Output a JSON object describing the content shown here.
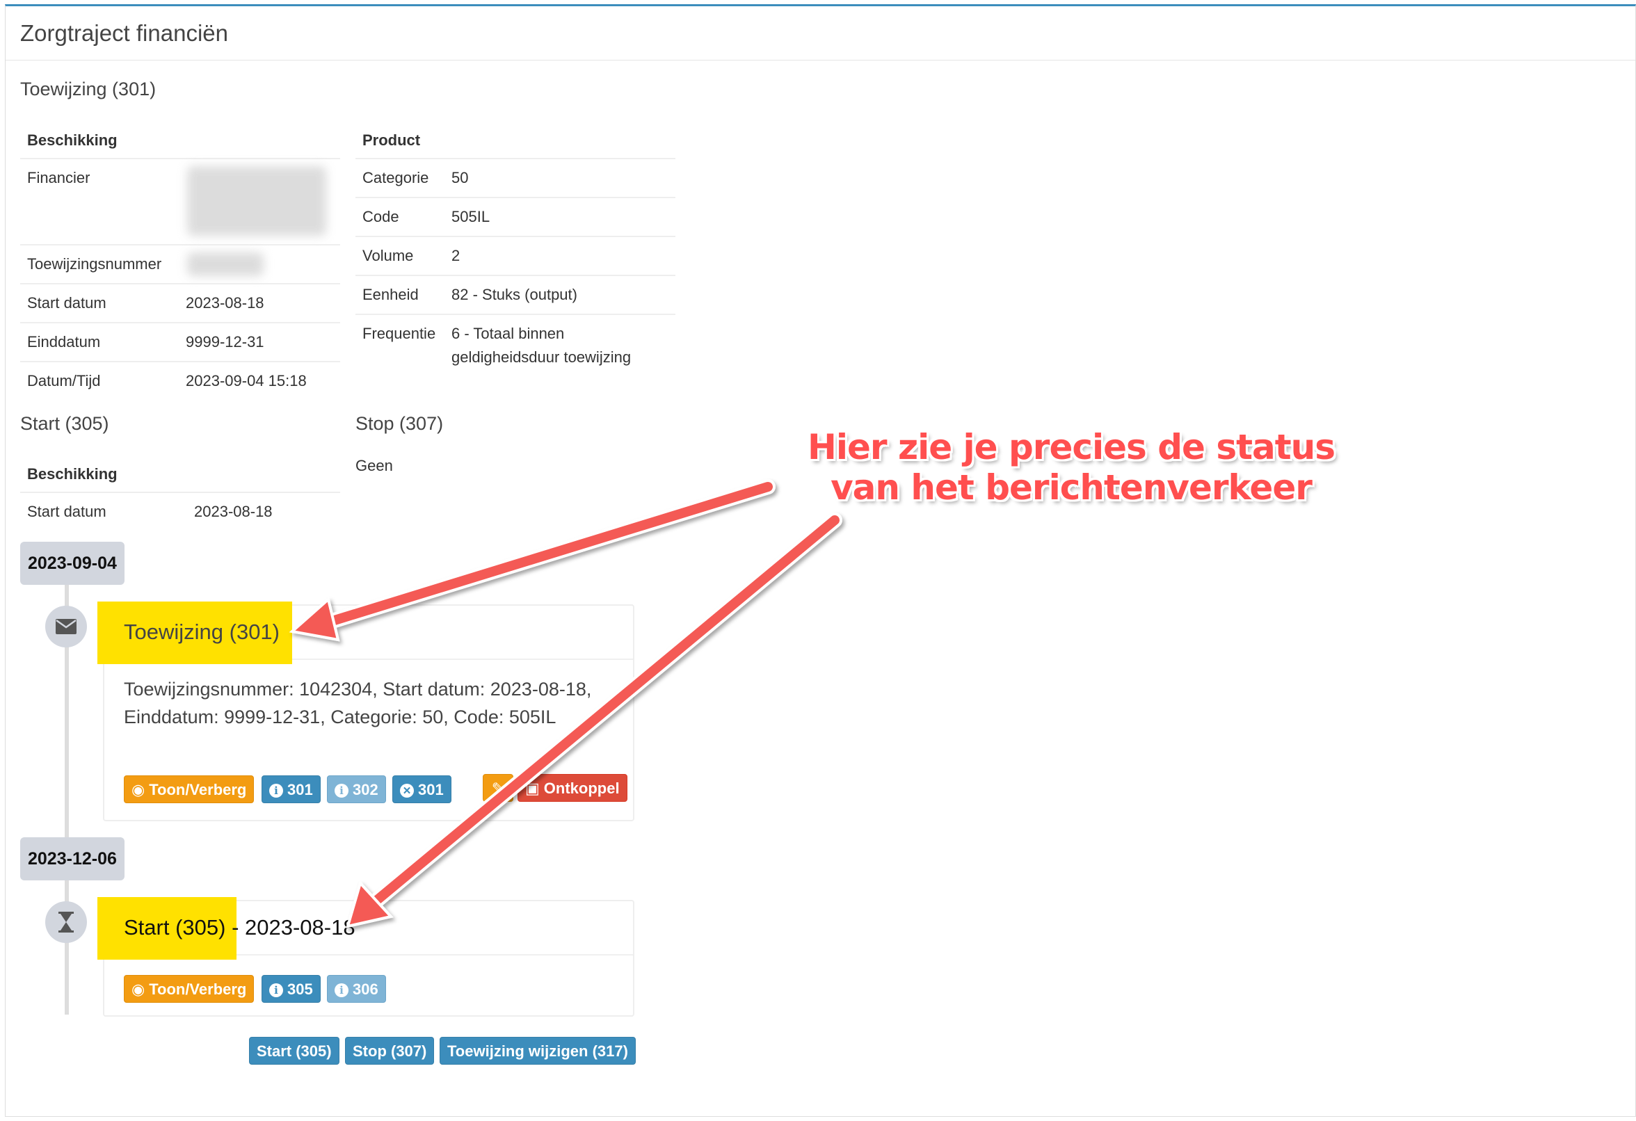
{
  "header": {
    "title": "Zorgtraject financiën"
  },
  "toewijzing": {
    "title": "Toewijzing (301)",
    "beschikking": {
      "heading": "Beschikking",
      "rows": [
        {
          "key": "Financier",
          "value": ""
        },
        {
          "key": "Toewijzingsnummer",
          "value": ""
        },
        {
          "key": "Start datum",
          "value": "2023-08-18"
        },
        {
          "key": "Einddatum",
          "value": "9999-12-31"
        },
        {
          "key": "Datum/Tijd",
          "value": "2023-09-04 15:18"
        }
      ]
    },
    "product": {
      "heading": "Product",
      "rows": [
        {
          "key": "Categorie",
          "value": "50"
        },
        {
          "key": "Code",
          "value": "505IL"
        },
        {
          "key": "Volume",
          "value": "2"
        },
        {
          "key": "Eenheid",
          "value": "82 - Stuks (output)"
        },
        {
          "key": "Frequentie",
          "value": "6 - Totaal binnen",
          "value2": "geldigheidsduur toewijzing"
        }
      ]
    }
  },
  "start": {
    "title": "Start (305)",
    "heading": "Beschikking",
    "rows": [
      {
        "key": "Start datum",
        "value": "2023-08-18"
      }
    ]
  },
  "stop": {
    "title": "Stop (307)",
    "value": "Geen"
  },
  "timeline": {
    "groups": [
      {
        "date": "2023-09-04",
        "icon": "envelope-icon",
        "item": {
          "title": "Toewijzing (301)",
          "body_line1": "Toewijzingsnummer: 1042304, Start datum: 2023-08-18,",
          "body_line2": "Einddatum: 9999-12-31, Categorie: 50, Code: 505IL",
          "buttons": {
            "toggle": "Toon/Verberg",
            "info301": "301",
            "info302": "302",
            "close301": "301",
            "ontkoppel": "Ontkoppel"
          }
        }
      },
      {
        "date": "2023-12-06",
        "icon": "hourglass-icon",
        "item": {
          "title": "Start (305)",
          "title_suffix": " - 2023-08-18",
          "buttons": {
            "toggle": "Toon/Verberg",
            "info305": "305",
            "info306": "306"
          }
        }
      }
    ],
    "actions": {
      "start": "Start (305)",
      "stop": "Stop (307)",
      "wijzigen": "Toewijzing wijzigen (317)"
    }
  },
  "annotation": {
    "line1": "Hier zie je precies de status",
    "line2": "van het berichtenverkeer",
    "color": "#ff4f4f"
  },
  "colors": {
    "accent": "#3c8dbc",
    "warning": "#f39c12",
    "danger": "#dd4b39",
    "highlight": "#ffe100"
  }
}
